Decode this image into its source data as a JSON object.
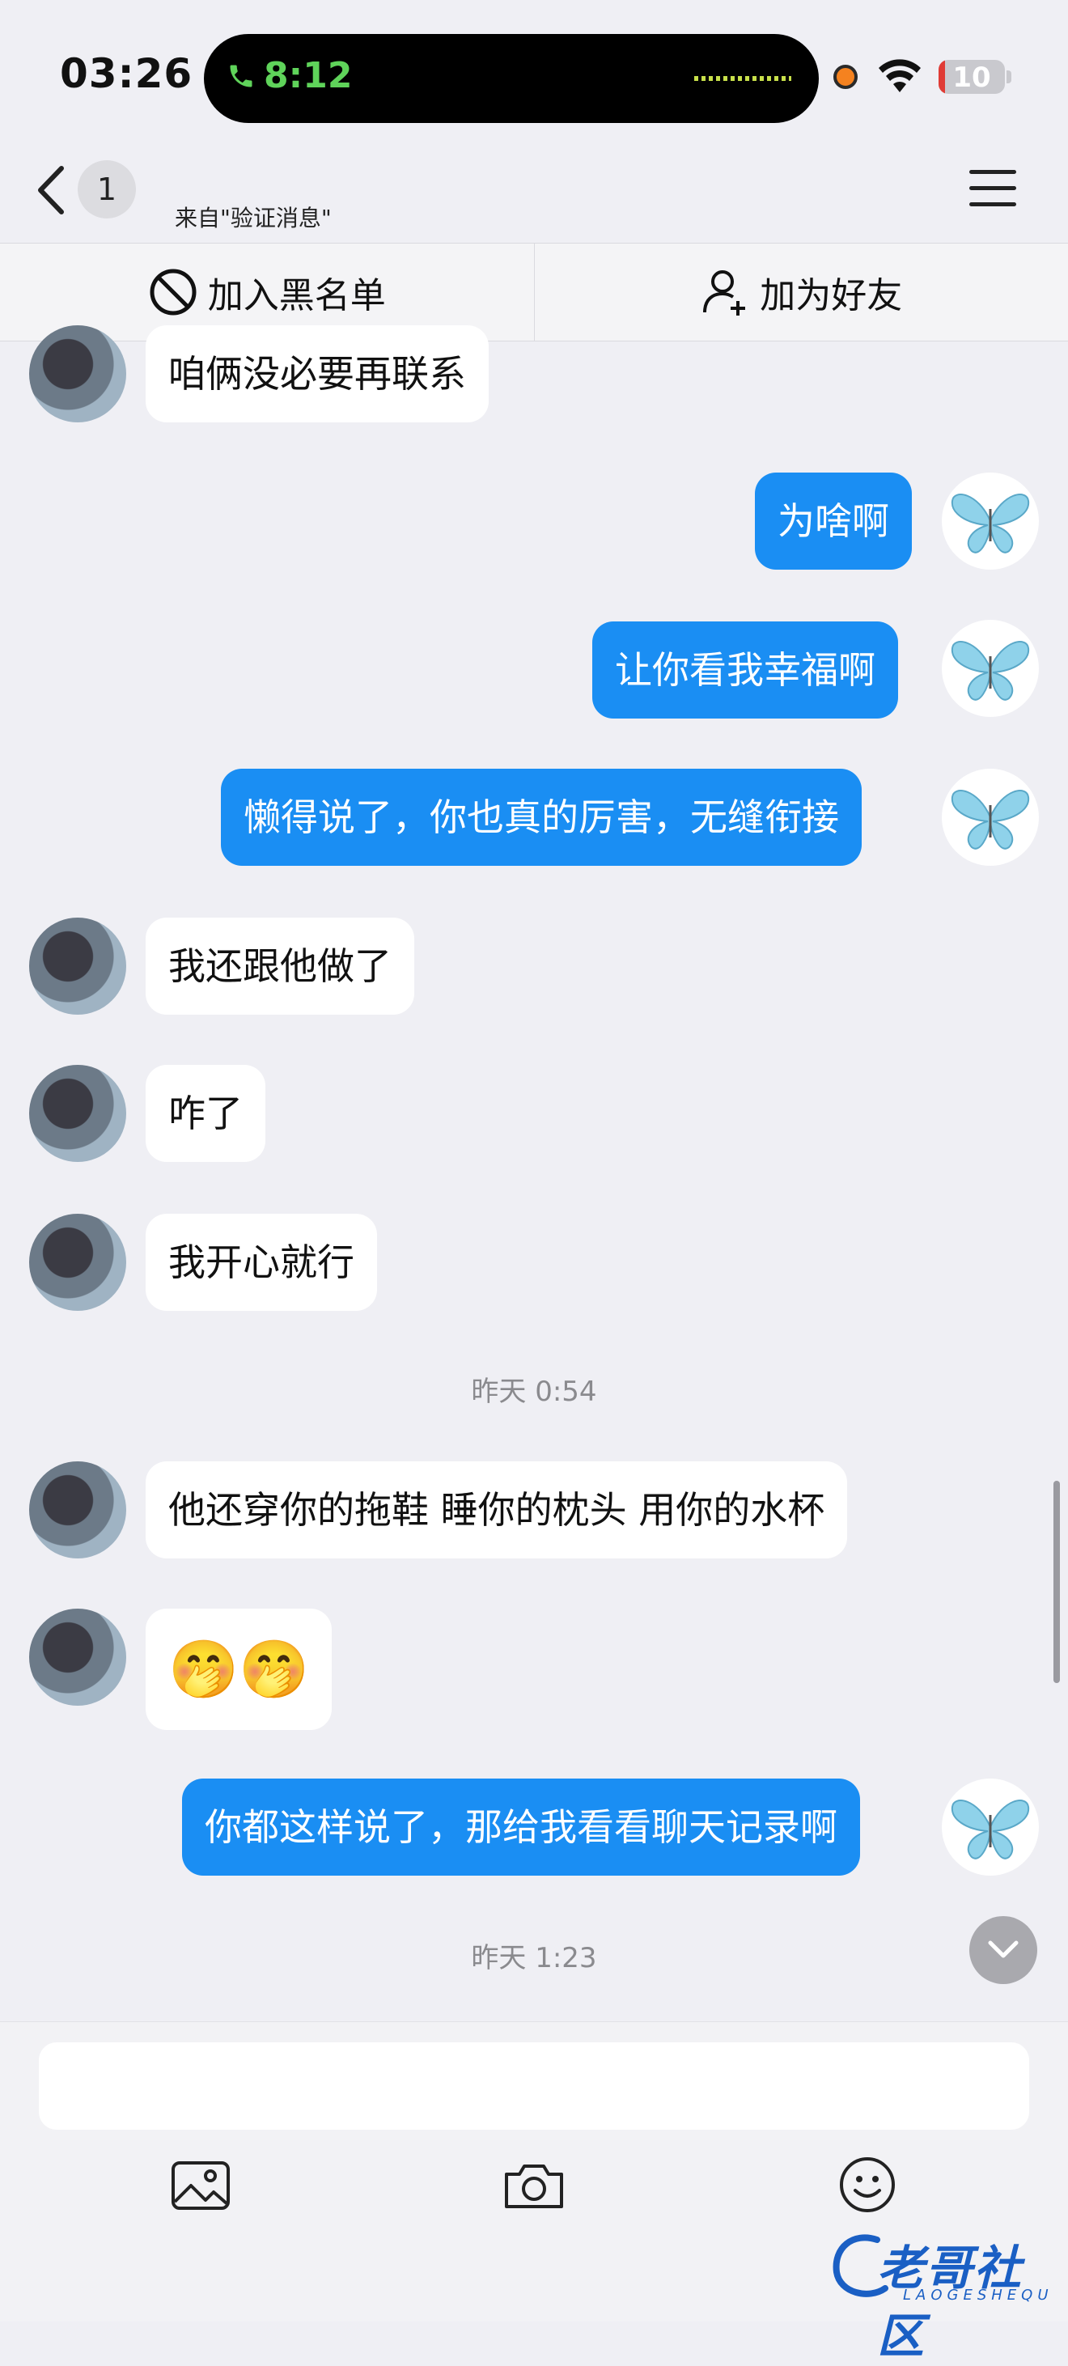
{
  "status_bar": {
    "time": "03:26",
    "call_timer": "8:12",
    "battery": "10"
  },
  "nav": {
    "badge_count": "1",
    "subtitle": "来自\"验证消息\""
  },
  "actions": {
    "blacklist": "加入黑名单",
    "add_friend": "加为好友"
  },
  "messages": [
    {
      "side": "in",
      "text": "咱俩没必要再联系"
    },
    {
      "side": "out",
      "text": "为啥啊"
    },
    {
      "side": "out",
      "text": "让你看我幸福啊"
    },
    {
      "side": "out",
      "text": "懒得说了，你也真的厉害，无缝衔接"
    },
    {
      "side": "in",
      "text": "我还跟他做了"
    },
    {
      "side": "in",
      "text": "咋了"
    },
    {
      "side": "in",
      "text": "我开心就行"
    },
    {
      "side": "in",
      "text": "他还穿你的拖鞋 睡你的枕头 用你的水杯"
    },
    {
      "side": "in",
      "text": "🤭🤭"
    },
    {
      "side": "out",
      "text": "你都这样说了，那给我看看聊天记录啊"
    }
  ],
  "timestamps": [
    "昨天 0:54",
    "昨天 1:23"
  ],
  "input": {
    "value": "",
    "placeholder": ""
  },
  "toolbar": {
    "icons": [
      "image-icon",
      "camera-icon",
      "emoji-icon"
    ]
  },
  "watermark": {
    "main": "老哥社区",
    "sub": "LAOGESHEQU"
  },
  "colors": {
    "outgoing_bubble": "#1a8ef3",
    "incoming_bubble": "#ffffff",
    "background": "#efeff4"
  }
}
